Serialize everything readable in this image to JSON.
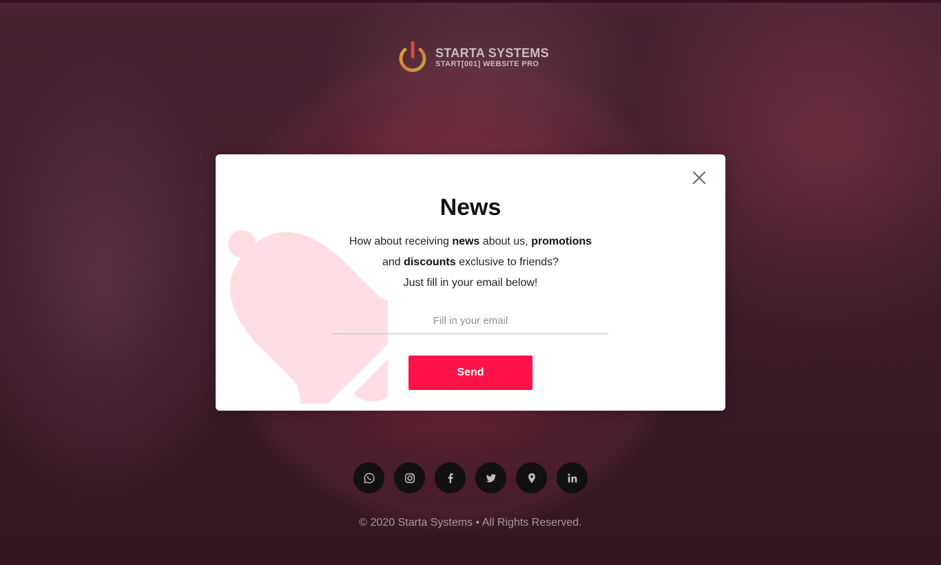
{
  "colors": {
    "accent": "#ff1248",
    "modal_bg": "#ffffff",
    "bell": "#ffdde3",
    "social_bg": "#121012"
  },
  "header": {
    "logo_name": "STARTA SYSTEMS",
    "logo_tagline": "START[001] WEBSITE PRO"
  },
  "modal": {
    "title": "News",
    "line1_prefix": "How about receiving ",
    "line1_bold1": "news",
    "line1_middle": " about us, ",
    "line1_bold2": "promotions",
    "line2_prefix": "and ",
    "line2_bold": "discounts",
    "line2_suffix": " exclusive to friends?",
    "line3": "Just fill in your email below!",
    "email_placeholder": "Fill in your email",
    "email_value": "",
    "send_label": "Send",
    "close_icon": "close-icon",
    "bell_icon": "bell-icon"
  },
  "social": [
    "whatsapp-icon",
    "instagram-icon",
    "facebook-icon",
    "twitter-icon",
    "location-icon",
    "linkedin-icon"
  ],
  "footer": {
    "copyright": "© 2020 Starta Systems • All Rights Reserved."
  }
}
